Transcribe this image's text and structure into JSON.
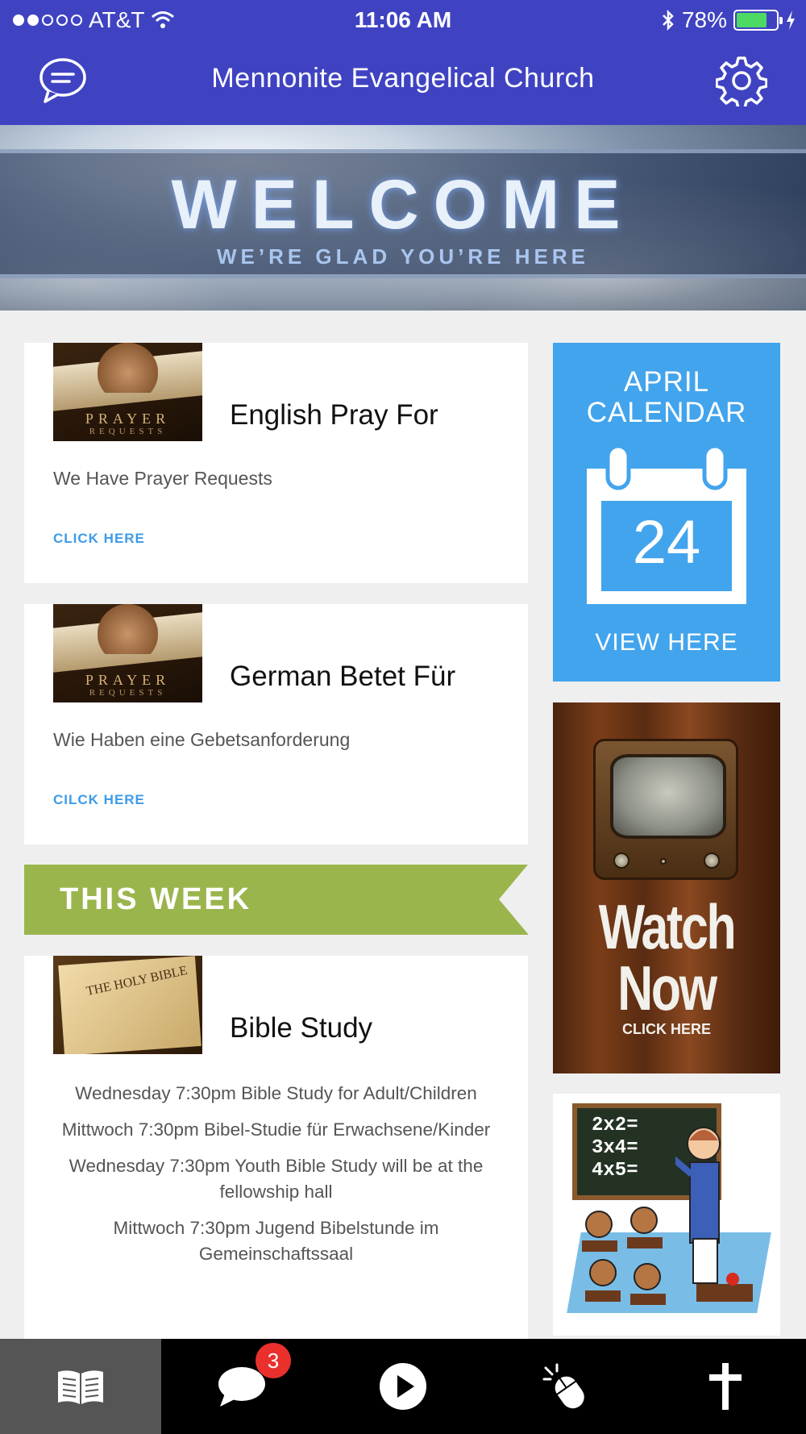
{
  "status_bar": {
    "carrier": "AT&T",
    "time": "11:06 AM",
    "battery": "78%",
    "battery_level": 0.78
  },
  "header": {
    "title": "Mennonite Evangelical Church",
    "left_icon": "chat-icon",
    "right_icon": "gear-icon"
  },
  "banner": {
    "title": "WELCOME",
    "subtitle": "WE’RE GLAD YOU’RE HERE"
  },
  "cards": [
    {
      "title": "English Pray For",
      "description": "We Have Prayer Requests",
      "link": "CLICK HERE",
      "thumb_text": "PRAYER",
      "thumb_sub": "REQUESTS"
    },
    {
      "title": "German Betet Für",
      "description": "Wie Haben eine Gebetsanforderung",
      "link": "CILCK HERE",
      "thumb_text": "PRAYER",
      "thumb_sub": "REQUESTS"
    }
  ],
  "this_week": {
    "label": "THIS WEEK"
  },
  "bible_study": {
    "title": "Bible Study",
    "thumb_text": "THE HOLY BIBLE",
    "lines": [
      "Wednesday 7:30pm Bible Study for Adult/Children",
      "Mittwoch 7:30pm Bibel-Studie für Erwachsene/Kinder",
      "Wednesday 7:30pm Youth Bible Study will be at the fellowship hall",
      "Mittwoch 7:30pm Jugend Bibelstunde im Gemeinschaftssaal"
    ]
  },
  "calendar_tile": {
    "title_line1": "APRIL",
    "title_line2": "CALENDAR",
    "day": "24",
    "cta": "VIEW HERE"
  },
  "watch_tile": {
    "line1": "Watch",
    "line2": "Now",
    "cta": "CLICK HERE"
  },
  "school_tile": {
    "board_lines": [
      "2x2=",
      "3x4=",
      "4x5="
    ]
  },
  "tabbar": {
    "tabs": [
      {
        "icon": "book-icon",
        "active": true
      },
      {
        "icon": "chat-bubble-icon",
        "badge": "3"
      },
      {
        "icon": "play-icon"
      },
      {
        "icon": "mouse-click-icon"
      },
      {
        "icon": "cross-icon"
      }
    ]
  },
  "colors": {
    "header": "#3f43c2",
    "calendar": "#42a4ec",
    "this_week": "#9bb54d",
    "link": "#3d9be9",
    "badge": "#e9302d"
  }
}
